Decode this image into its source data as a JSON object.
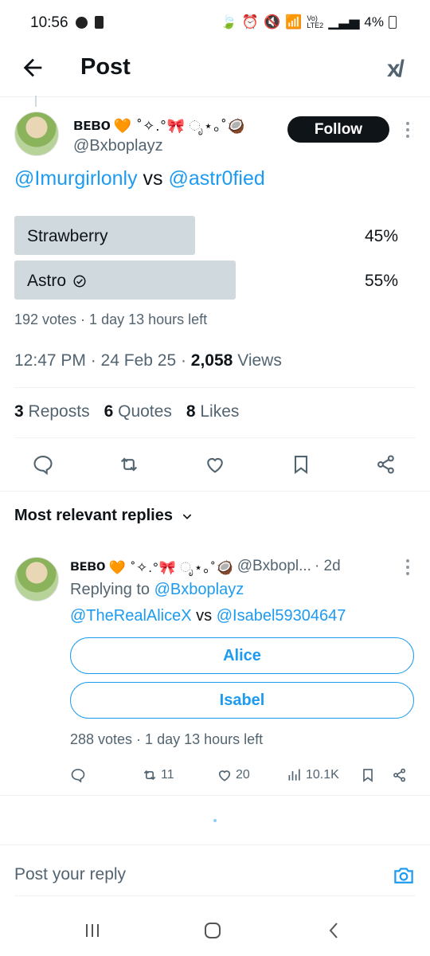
{
  "status": {
    "time": "10:56",
    "battery": "4%"
  },
  "header": {
    "title": "Post"
  },
  "post": {
    "author_name": "ʙᴇʙᴏ",
    "author_deco": "🧡 ˚✧.°🎀 ೃ⋆｡˚🥥",
    "author_handle": "@Bxboplayz",
    "follow_label": "Follow",
    "mention1": "@Imurgirlonly",
    "vs": "vs",
    "mention2": "@astr0fied",
    "poll": {
      "options": [
        {
          "label": "Strawberry",
          "percent": 45,
          "percent_text": "45%"
        },
        {
          "label": "Astro",
          "percent": 55,
          "percent_text": "55%"
        }
      ],
      "meta": "192 votes · 1 day 13 hours left"
    },
    "timestamp": "12:47 PM · 24 Feb 25 · ",
    "views_count": "2,058",
    "views_label": " Views",
    "reposts_count": "3",
    "reposts_label": "Reposts",
    "quotes_count": "6",
    "quotes_label": "Quotes",
    "likes_count": "8",
    "likes_label": "Likes"
  },
  "replies_header": "Most relevant replies",
  "reply": {
    "author_name": "ʙᴇʙᴏ",
    "author_deco": "🧡 ˚✧.°🎀 ೃ⋆｡˚🥥",
    "author_handle": "@Bxbopl...",
    "age": "· 2d",
    "replying_prefix": "Replying to ",
    "replying_to": "@Bxboplayz",
    "mention1": "@TheRealAliceX",
    "vs": "vs",
    "mention2": "@Isabel59304647",
    "options": [
      "Alice",
      "Isabel"
    ],
    "meta": "288 votes · 1 day 13 hours left",
    "repost_count": "11",
    "like_count": "20",
    "view_count": "10.1K"
  },
  "compose": {
    "placeholder": "Post your reply"
  },
  "colors": {
    "accent": "#1d9bf0",
    "text": "#0f1419",
    "muted": "#536471",
    "poll_bar": "#cfd9de"
  }
}
